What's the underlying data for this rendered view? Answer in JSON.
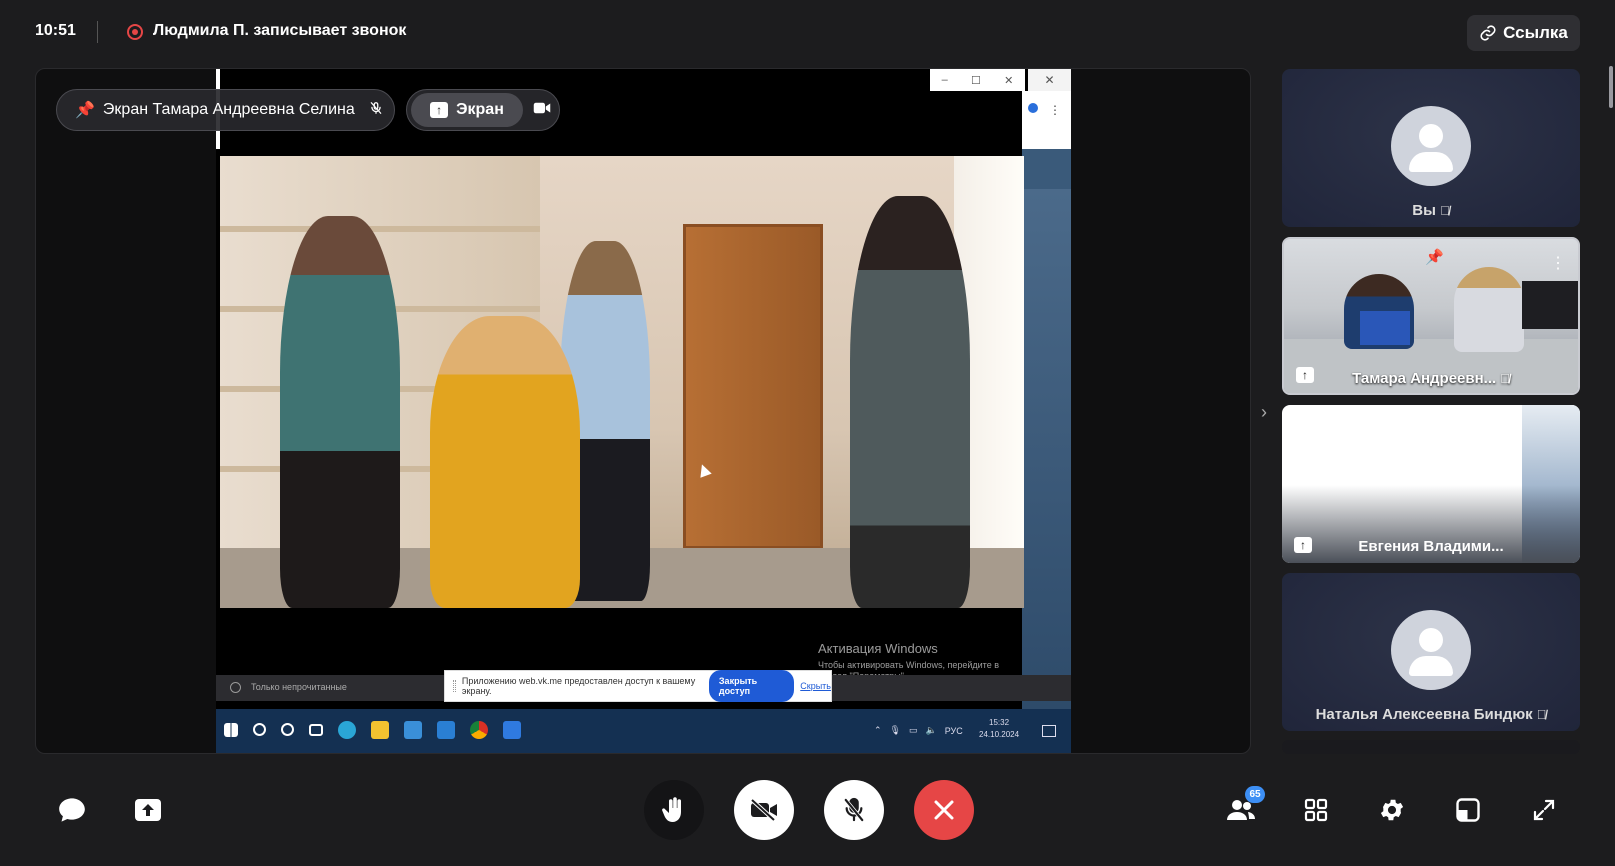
{
  "header": {
    "time": "10:51",
    "recording_text": "Людмила П. записывает звонок",
    "link_button": "Ссылка"
  },
  "stage": {
    "pinned_label": "Экран Тамара Андреевна Селина",
    "screen_tab": "Экран",
    "shared_screen": {
      "activation_title": "Активация Windows",
      "activation_text": "Чтобы активировать Windows, перейдите в раздел \"Параметры\".",
      "unread_label": "Только непрочитанные",
      "share_notice": "Приложению web.vk.me предоставлен доступ к вашему экрану.",
      "close_access": "Закрыть доступ",
      "hide": "Скрыть",
      "tray_lang": "РУС",
      "tray_time": "15:32",
      "tray_date": "24.10.2024"
    }
  },
  "participants": [
    {
      "name": "Вы",
      "muted": true
    },
    {
      "name": "Тамара Андреевн...",
      "muted": true,
      "pinned": true,
      "sharing": true
    },
    {
      "name": "Евгения Владими...",
      "muted": false,
      "sharing": true
    },
    {
      "name": "Наталья Алексеевна Биндюк",
      "muted": true
    }
  ],
  "controls": {
    "participants_count": "65"
  },
  "icons": {
    "pin": "pin-icon",
    "mic_off": "mic-off-icon",
    "camera": "camera-icon",
    "share": "share-screen-icon",
    "chat": "chat-icon",
    "hand": "raise-hand-icon",
    "camera_off": "camera-off-icon",
    "end_call": "end-call-icon",
    "people": "participants-icon",
    "grid": "grid-icon",
    "settings": "gear-icon",
    "layout": "layout-icon",
    "fullscreen": "fullscreen-icon",
    "link": "link-icon"
  },
  "colors": {
    "recording": "#e64646",
    "end_call": "#e64646",
    "badge": "#3d8ff5",
    "background": "#1c1c1e"
  }
}
